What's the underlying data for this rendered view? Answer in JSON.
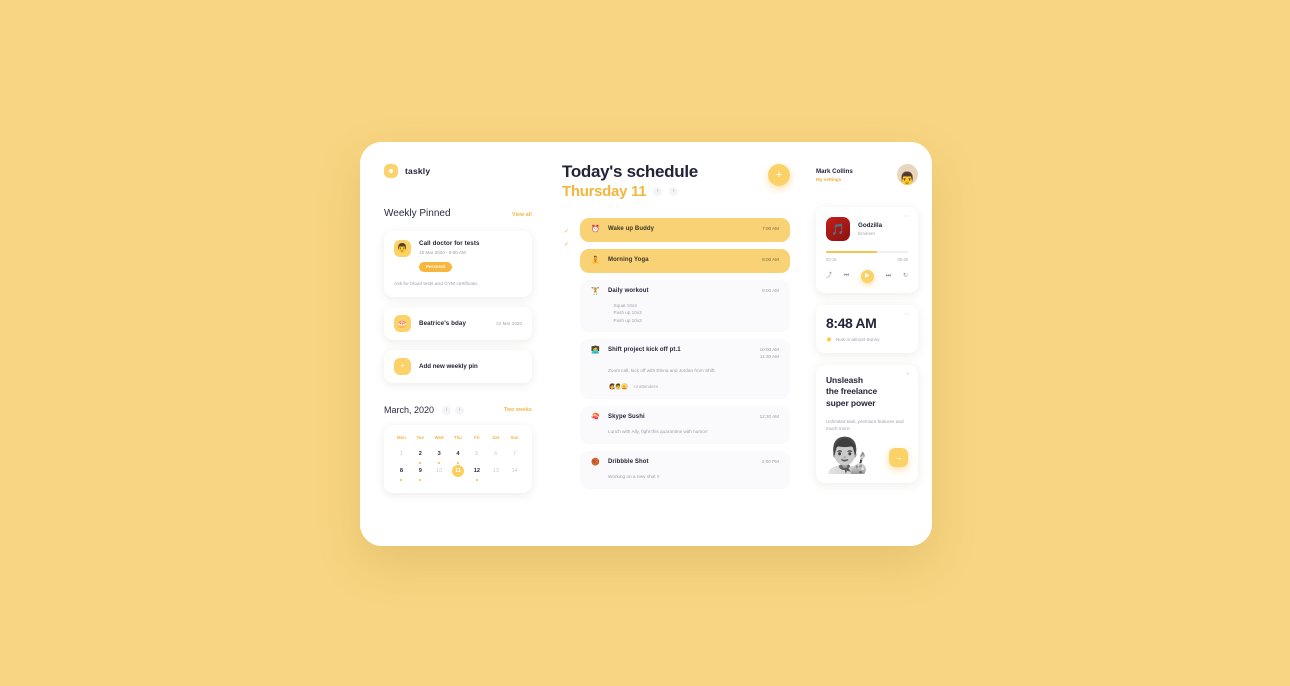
{
  "theme": {
    "background": "#F8D582",
    "accent": "#FBD268",
    "accent_text": "#F2B33D",
    "surface": "#FFFFFF",
    "ink": "#24243A",
    "muted": "#9D9DAB"
  },
  "sidebar": {
    "brand": "taskly",
    "pinned_section": {
      "title": "Weekly Pinned",
      "view_all": "View all"
    },
    "pins": [
      {
        "icon": "person-icon",
        "emoji": "👨",
        "title": "Call doctor for tests",
        "meta": "15 Mar 2020 - 9:00 AM",
        "badge": "Personal",
        "note": "Ask for blood tests and GYM certificate."
      },
      {
        "icon": "cake-icon",
        "emoji": "🎂",
        "title": "Beatrice's bday",
        "date": "22 Mar 2020"
      },
      {
        "icon": "plus-icon",
        "emoji": "+",
        "title": "Add new weekly pin"
      }
    ],
    "calendar": {
      "title": "March, 2020",
      "range_label": "Two weeks",
      "prev": "‹",
      "next": "›",
      "weekdays": [
        "Mon",
        "Tue",
        "Wed",
        "Thu",
        "Fri",
        "Sat",
        "Sun"
      ],
      "weeks": [
        [
          {
            "day": "1",
            "muted": true,
            "dot": false,
            "active": false
          },
          {
            "day": "2",
            "muted": false,
            "dot": true,
            "active": false
          },
          {
            "day": "3",
            "muted": false,
            "dot": true,
            "active": false
          },
          {
            "day": "4",
            "muted": false,
            "dot": true,
            "active": false
          },
          {
            "day": "5",
            "muted": true,
            "dot": false,
            "active": false
          },
          {
            "day": "6",
            "muted": true,
            "dot": false,
            "active": false
          },
          {
            "day": "7",
            "muted": true,
            "dot": false,
            "active": false
          }
        ],
        [
          {
            "day": "8",
            "muted": false,
            "dot": true,
            "active": false
          },
          {
            "day": "9",
            "muted": false,
            "dot": true,
            "active": false
          },
          {
            "day": "10",
            "muted": true,
            "dot": false,
            "active": false
          },
          {
            "day": "11",
            "muted": false,
            "dot": false,
            "active": true
          },
          {
            "day": "12",
            "muted": false,
            "dot": true,
            "active": false
          },
          {
            "day": "13",
            "muted": true,
            "dot": false,
            "active": false
          },
          {
            "day": "14",
            "muted": true,
            "dot": false,
            "active": false
          }
        ]
      ]
    }
  },
  "main": {
    "title": "Today's schedule",
    "subtitle": "Thursday 11",
    "prev": "‹",
    "next": "›",
    "add": "+",
    "tasks": [
      {
        "emoji": "⏰",
        "icon": "alarm-icon",
        "name": "Wake up Buddy",
        "time": "7:00 AM",
        "done": true,
        "rail": "check"
      },
      {
        "emoji": "🧘",
        "icon": "yoga-icon",
        "name": "Morning Yoga",
        "time": "8:00 AM",
        "done": true,
        "rail": "check"
      },
      {
        "emoji": "🏋️",
        "icon": "workout-icon",
        "name": "Daily workout",
        "time": "9:00 AM",
        "done": false,
        "rail": "dot",
        "checklist": [
          "Squat 10x3",
          "Push up 10x3",
          "Push up 10x3"
        ]
      },
      {
        "emoji": "👩‍💻",
        "icon": "meeting-icon",
        "name": "Shift project kick off pt.1",
        "time": "10:00 AM\n11:30 AM",
        "time_start": "10:00 AM",
        "time_end": "11:30 AM",
        "done": false,
        "rail": "dot",
        "description": "Zoom call, kick off with Elena and Jordan from Shift.",
        "attendees_label": "+3 attendees",
        "attendee_emojis": [
          "👩",
          "👨",
          "👱"
        ]
      },
      {
        "emoji": "🍣",
        "icon": "sushi-icon",
        "name": "Skype Sushi",
        "time": "12:30 AM",
        "done": false,
        "rail": "dot",
        "description": "Lunch with Ally, fight this quarantine with humor!"
      },
      {
        "emoji": "🏀",
        "icon": "dribbble-icon",
        "name": "Dribbble Shot",
        "time": "2:00 PM",
        "done": false,
        "rail": "dot",
        "description": "Working on a new shot !!"
      }
    ]
  },
  "right": {
    "user": {
      "name": "Mark Collins",
      "link": "My settings",
      "avatar_emoji": "👨"
    },
    "player": {
      "album_emoji": "🎵",
      "song": "Godzilla",
      "artist": "Eminem",
      "elapsed": "03:15",
      "remaining": "00:45",
      "shuffle": "⤴",
      "prev": "⏮",
      "play": "▶",
      "next": "⏭",
      "repeat": "↻",
      "menu": "⋯"
    },
    "clock": {
      "time": "8:48 AM",
      "weather_emoji": "☀️",
      "weather_text": "Now is almost Sunny",
      "menu": "⋯"
    },
    "promo": {
      "title": "Unsleash\nthe freelance\nsuper power",
      "line1": "Unsleash",
      "line2": "the freelance",
      "line3": "super power",
      "subtitle": "Unlimited task, premium features and much more.",
      "art_emoji": "👨‍🎨",
      "cta": "→",
      "close": "×"
    }
  }
}
